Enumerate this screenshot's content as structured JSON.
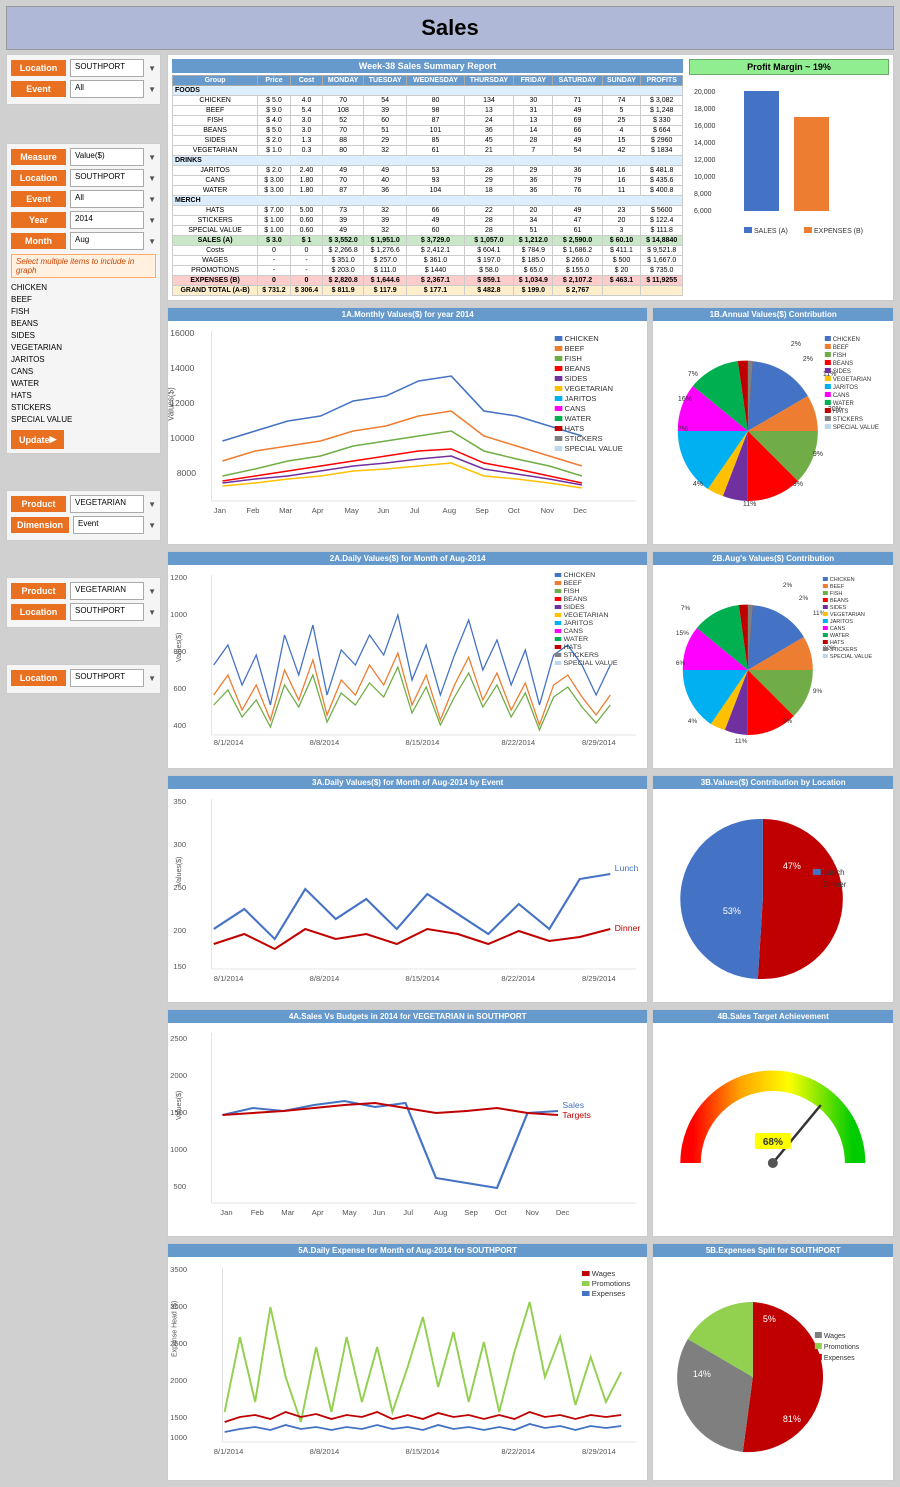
{
  "page": {
    "title": "Sales"
  },
  "controls": {
    "location_label": "Location",
    "location_value": "SOUTHPORT",
    "event_label": "Event",
    "event_value": "All",
    "measure_label": "Measure",
    "measure_value": "Value($)",
    "year_label": "Year",
    "year_value": "2014",
    "month_label": "Month",
    "month_value": "Aug",
    "product_label": "Product",
    "product_value": "VEGETARIAN",
    "dimension_label": "Dimension",
    "dimension_value": "Event"
  },
  "week_report": {
    "title": "Week-38 Sales Summary Report",
    "profit_margin": "Profit Margin ~ 19%"
  },
  "charts": {
    "chart1a_title": "1A.Monthly Values($) for year 2014",
    "chart1b_title": "1B.Annual Values($) Contribution",
    "chart2a_title": "2A.Daily Values($) for Month of Aug-2014",
    "chart2b_title": "2B.Aug's Values($) Contribution",
    "chart3a_title": "3A.Daily Values($) for Month of Aug-2014 by Event",
    "chart3b_title": "3B.Values($) Contribution by Location",
    "chart4a_title": "4A.Sales Vs Budgets in 2014 for VEGETARIAN in SOUTHPORT",
    "chart4b_title": "4B.Sales Target Achievement",
    "chart5a_title": "5A.Daily Expense for Month of Aug-2014 for SOUTHPORT",
    "chart5b_title": "5B.Expenses Split for SOUTHPORT",
    "gauge_value": "68%"
  },
  "products": [
    "CHICKEN",
    "BEEF",
    "FISH",
    "BEANS",
    "SIDES",
    "VEGETARIAN",
    "JARITOS",
    "CANS",
    "WATER",
    "HATS",
    "STICKERS",
    "SPECIAL VALUE"
  ],
  "colors": {
    "chicken": "#4472C4",
    "beef": "#ED7D31",
    "fish": "#A9D18E",
    "beans": "#FF0000",
    "sides": "#7030A0",
    "vegetarian": "#FFC000",
    "jaritos": "#00B0F0",
    "cans": "#FF00FF",
    "water": "#00B050",
    "hats": "#C00000",
    "stickers": "#808080",
    "special_value": "#BDD7EE",
    "lunch": "#4472C4",
    "dinner": "#C00000",
    "sales": "#4472C4",
    "targets": "#C00000",
    "wages": "#C00000",
    "promotions": "#92D050",
    "expenses": "#4472C4"
  }
}
